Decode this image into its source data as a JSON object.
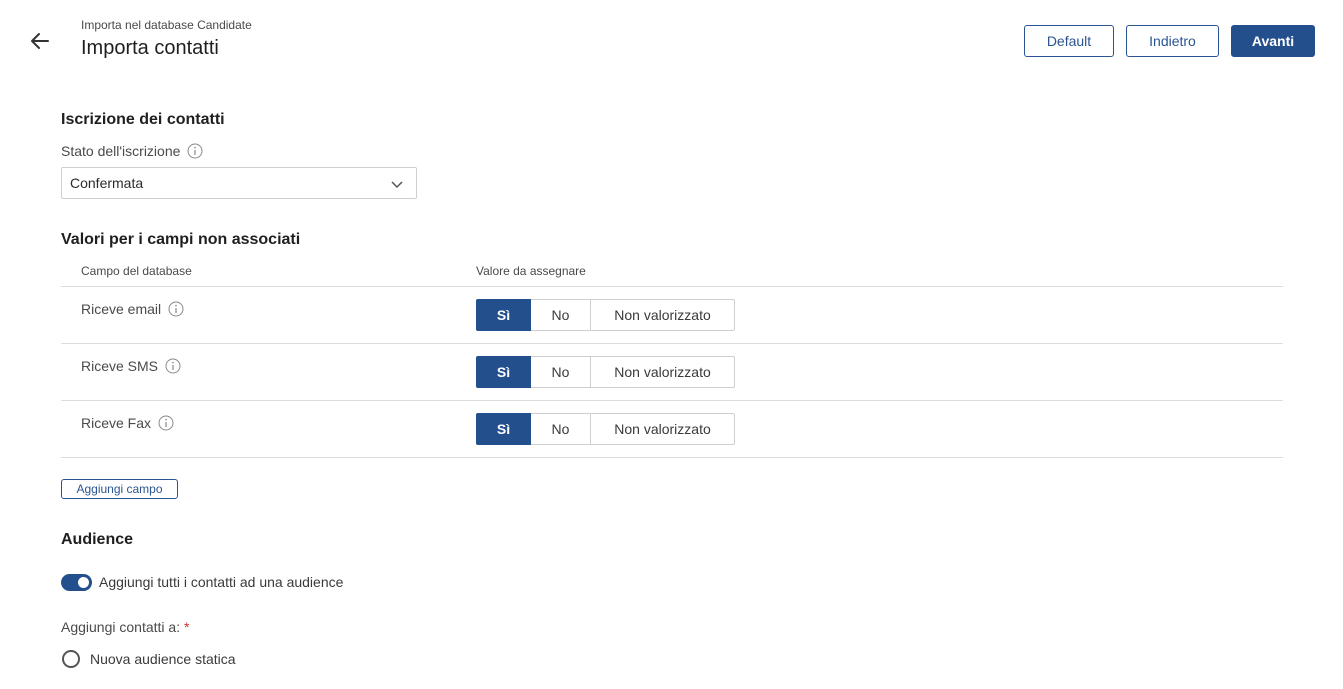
{
  "header": {
    "breadcrumb": "Importa nel database Candidate",
    "title": "Importa contatti",
    "buttons": {
      "default": "Default",
      "back": "Indietro",
      "next": "Avanti"
    }
  },
  "subscription": {
    "section_title": "Iscrizione dei contatti",
    "status_label": "Stato dell'iscrizione",
    "status_value": "Confermata"
  },
  "unmapped": {
    "section_title": "Valori per i campi non associati",
    "col_field": "Campo del database",
    "col_value": "Valore da assegnare",
    "rows": [
      {
        "label": "Riceve email",
        "options": [
          "Sì",
          "No",
          "Non valorizzato"
        ],
        "selected": "Sì"
      },
      {
        "label": "Riceve SMS",
        "options": [
          "Sì",
          "No",
          "Non valorizzato"
        ],
        "selected": "Sì"
      },
      {
        "label": "Riceve Fax",
        "options": [
          "Sì",
          "No",
          "Non valorizzato"
        ],
        "selected": "Sì"
      }
    ],
    "add_field": "Aggiungi campo"
  },
  "audience": {
    "section_title": "Audience",
    "toggle_label": "Aggiungi tutti i contatti ad una audience",
    "toggle_on": true,
    "add_to_label": "Aggiungi contatti a:",
    "required_mark": "*",
    "radio_option": "Nuova audience statica"
  },
  "colors": {
    "accent": "#234f8d",
    "required": "#d0312d"
  }
}
